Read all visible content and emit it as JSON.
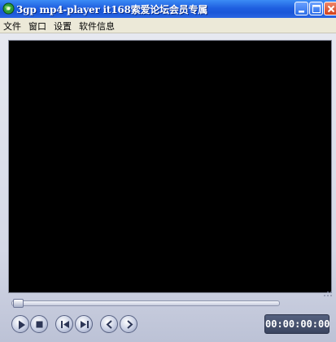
{
  "window": {
    "title": "3gp mp4-player it168索爱论坛会员专属",
    "app_icon": "globe-icon",
    "buttons": {
      "minimize": "minimize-icon",
      "maximize": "maximize-icon",
      "close": "close-icon"
    },
    "colors": {
      "titlebar": "#1f5fe0",
      "close": "#d2421c"
    }
  },
  "menu": {
    "items": [
      "文件",
      "窗口",
      "设置",
      "软件信息"
    ]
  },
  "player": {
    "video_color": "#000000",
    "seek_position": 0.0,
    "controls": [
      "play-icon",
      "stop-icon",
      "skip-previous-icon",
      "skip-next-icon",
      "chevron-left-icon",
      "chevron-right-icon"
    ],
    "time": "00:00:00:00",
    "colors": {
      "time_display": "#3b4560",
      "controls": "#c9d0e4"
    }
  }
}
